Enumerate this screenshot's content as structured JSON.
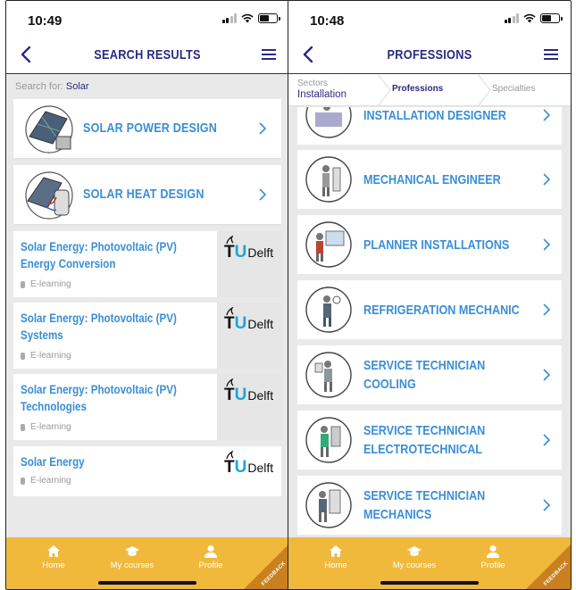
{
  "left": {
    "status": {
      "time": "10:49"
    },
    "nav": {
      "title": "SEARCH RESULTS"
    },
    "search": {
      "prefix": "Search for:",
      "term": "Solar"
    },
    "cards": [
      {
        "title": "SOLAR POWER DESIGN"
      },
      {
        "title": "SOLAR HEAT DESIGN"
      }
    ],
    "courses": [
      {
        "title": "Solar Energy: Photovoltaic (PV) Energy Conversion",
        "type": "E-learning",
        "provider": "Delft"
      },
      {
        "title": "Solar Energy: Photovoltaic (PV) Systems",
        "type": "E-learning",
        "provider": "Delft"
      },
      {
        "title": "Solar Energy: Photovoltaic (PV) Technologies",
        "type": "E-learning",
        "provider": "Delft"
      },
      {
        "title": "Solar Energy",
        "type": "E-learning",
        "provider": "Delft"
      }
    ]
  },
  "right": {
    "status": {
      "time": "10:48"
    },
    "nav": {
      "title": "PROFESSIONS"
    },
    "breadcrumb": {
      "sectors_label": "Sectors",
      "sectors_value": "Installation",
      "professions": "Professions",
      "specialties": "Specialties"
    },
    "professions": [
      {
        "title": "INSTALLATION DESIGNER"
      },
      {
        "title": "MECHANICAL ENGINEER"
      },
      {
        "title": "PLANNER INSTALLATIONS"
      },
      {
        "title": "REFRIGERATION MECHANIC"
      },
      {
        "title": "SERVICE TECHNICIAN COOLING"
      },
      {
        "title": "SERVICE TECHNICIAN ELECTROTECHNICAL"
      },
      {
        "title": "SERVICE TECHNICIAN MECHANICS"
      }
    ]
  },
  "tabbar": {
    "home": "Home",
    "courses": "My courses",
    "profile": "Profile",
    "feedback": "FEEDBACK"
  },
  "colors": {
    "navy": "#2b2a80",
    "link_blue": "#3a8ed6",
    "tab_yellow": "#f0b93c",
    "feedback_orange": "#c9801f"
  }
}
